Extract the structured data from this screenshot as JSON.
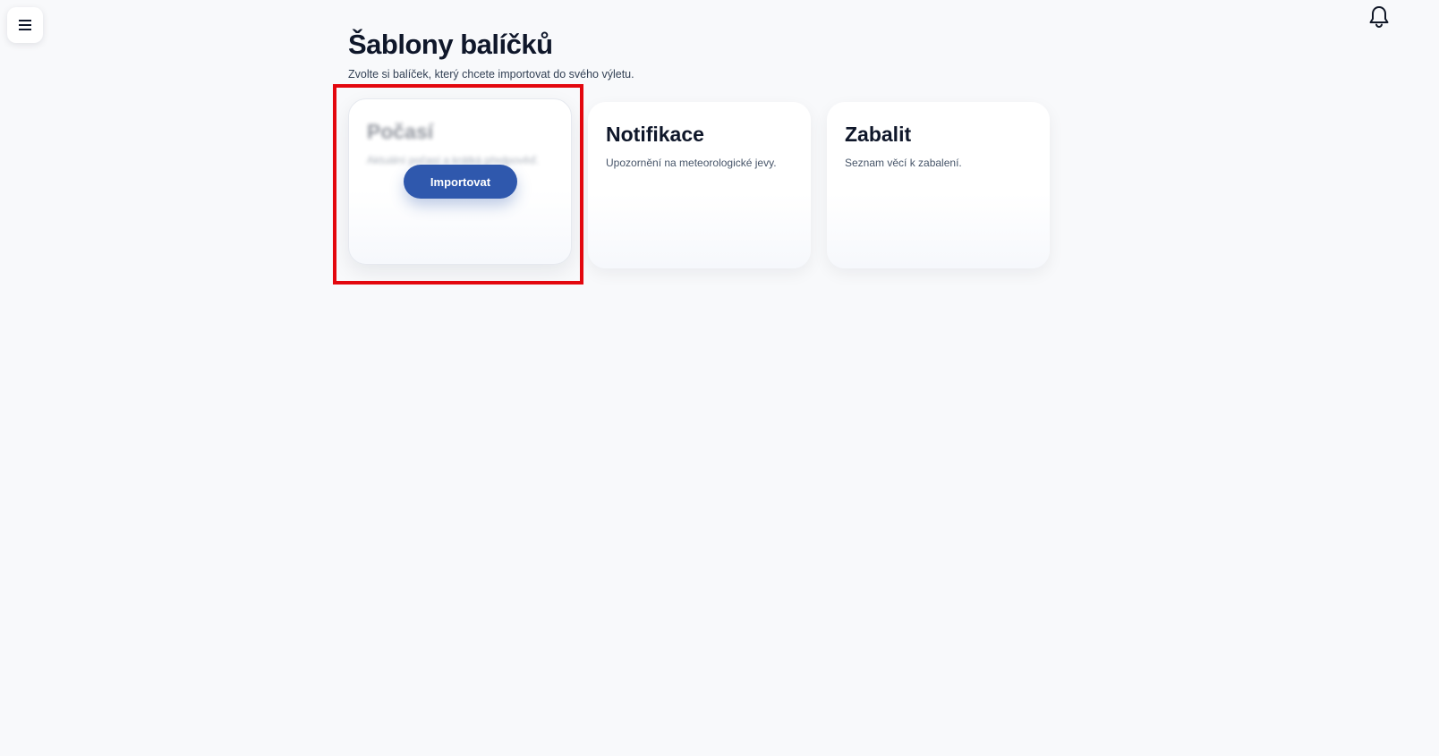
{
  "nav": {
    "menu_icon": "hamburger-menu-icon",
    "notifications_icon": "bell-icon"
  },
  "header": {
    "title": "Šablony balíčků",
    "subtitle": "Zvolte si balíček, který chcete importovat do svého výletu."
  },
  "templates": [
    {
      "title": "Počasí",
      "description": "Aktuální počasí a krátká předpověď.",
      "action_label": "Importovat"
    },
    {
      "title": "Notifikace",
      "description": "Upozornění na meteorologické jevy."
    },
    {
      "title": "Zabalit",
      "description": "Seznam věcí k zabalení."
    }
  ],
  "colors": {
    "background": "#f8f9fb",
    "primary_button": "#2f58ad",
    "highlight": "#e3070e",
    "title_text": "#0f172a"
  }
}
